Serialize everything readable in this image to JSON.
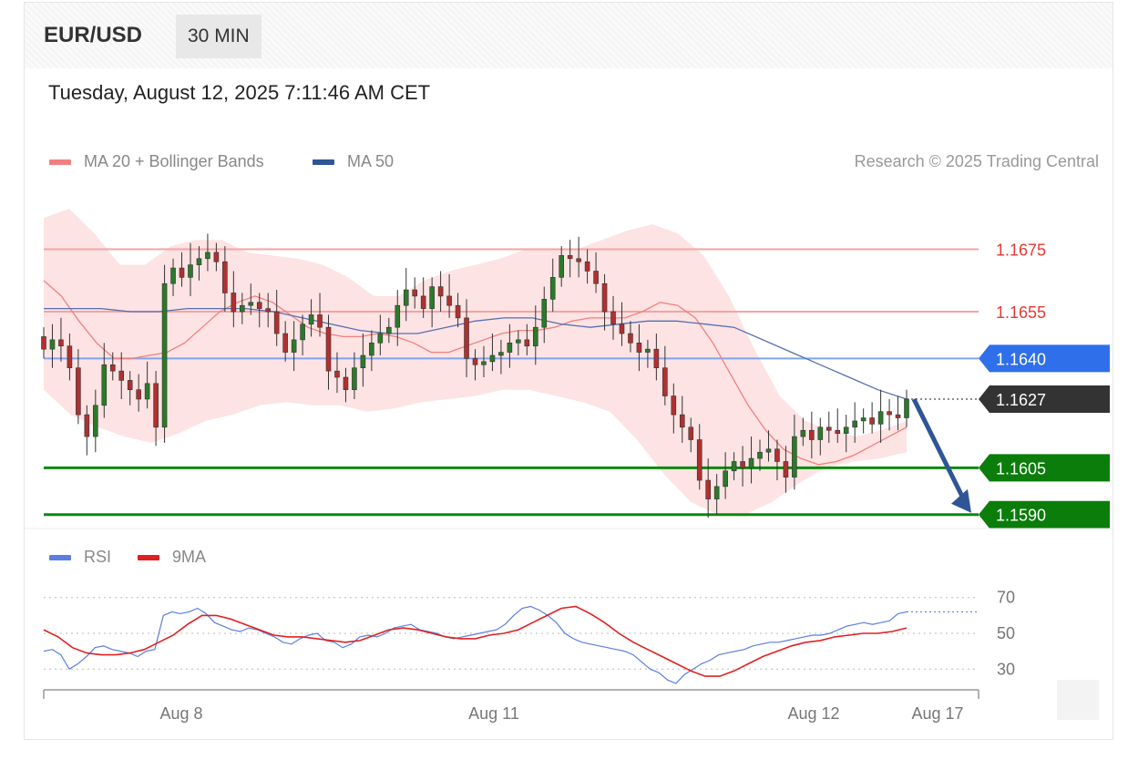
{
  "header": {
    "pair": "EUR/USD",
    "timeframe": "30 MIN"
  },
  "datetime": "Tuesday, August 12, 2025 7:11:46 AM CET",
  "legend": {
    "ma20": {
      "label": "MA 20 + Bollinger Bands",
      "color": "#f08080"
    },
    "ma50": {
      "label": "MA 50",
      "color": "#2f5597"
    }
  },
  "credit": "Research © 2025 Trading Central",
  "rsi_legend": {
    "rsi": {
      "label": "RSI",
      "color": "#5b7fe0"
    },
    "ma9": {
      "label": "9MA",
      "color": "#e02020"
    }
  },
  "chart_data": [
    {
      "type": "candlestick",
      "title": "EUR/USD",
      "timeframe": "30 MIN",
      "x_tick_labels": [
        "Aug 8",
        "Aug 11",
        "Aug 12",
        "Aug 17"
      ],
      "ylim": [
        1.1587,
        1.1695
      ],
      "levels": [
        {
          "value": 1.1675,
          "label": "1.1675",
          "kind": "resistance",
          "color": "#e53935"
        },
        {
          "value": 1.1655,
          "label": "1.1655",
          "kind": "resistance",
          "color": "#e53935"
        },
        {
          "value": 1.164,
          "label": "1.1640",
          "kind": "pivot",
          "color": "#2f6fea"
        },
        {
          "value": 1.1627,
          "label": "1.1627",
          "kind": "last_price",
          "color": "#333333"
        },
        {
          "value": 1.1605,
          "label": "1.1605",
          "kind": "support",
          "color": "#0a8a0a"
        },
        {
          "value": 1.159,
          "label": "1.1590",
          "kind": "support",
          "color": "#0a8a0a"
        }
      ],
      "close_series": [
        1.1643,
        1.1646,
        1.1644,
        1.1637,
        1.1622,
        1.1615,
        1.1625,
        1.1638,
        1.1636,
        1.1633,
        1.163,
        1.1627,
        1.1632,
        1.1618,
        1.1664,
        1.1669,
        1.1666,
        1.167,
        1.1672,
        1.1674,
        1.1671,
        1.1661,
        1.1655,
        1.1657,
        1.1658,
        1.1656,
        1.1655,
        1.1648,
        1.1642,
        1.1646,
        1.1651,
        1.1654,
        1.165,
        1.1636,
        1.1634,
        1.163,
        1.1637,
        1.1641,
        1.1645,
        1.1648,
        1.165,
        1.1657,
        1.1662,
        1.166,
        1.1656,
        1.1663,
        1.166,
        1.1657,
        1.1653,
        1.164,
        1.1638,
        1.1639,
        1.1641,
        1.1642,
        1.1645,
        1.1646,
        1.1644,
        1.165,
        1.1659,
        1.1666,
        1.1673,
        1.1672,
        1.1671,
        1.1668,
        1.1664,
        1.1655,
        1.1651,
        1.1648,
        1.1645,
        1.1642,
        1.1643,
        1.1637,
        1.1628,
        1.1622,
        1.1618,
        1.1614,
        1.1601,
        1.1595,
        1.1599,
        1.1604,
        1.1607,
        1.1605,
        1.1608,
        1.161,
        1.1611,
        1.1607,
        1.1602,
        1.1615,
        1.1617,
        1.1614,
        1.1618,
        1.1617,
        1.1616,
        1.1618,
        1.162,
        1.1621,
        1.1619,
        1.1623,
        1.1622,
        1.1621,
        1.1627
      ],
      "ma20_series": [
        1.1665,
        1.166,
        1.1652,
        1.1645,
        1.164,
        1.164,
        1.1641,
        1.1642,
        1.1645,
        1.165,
        1.1655,
        1.1658,
        1.166,
        1.1658,
        1.1654,
        1.165,
        1.1648,
        1.1647,
        1.1647,
        1.1648,
        1.1647,
        1.1645,
        1.1642,
        1.1642,
        1.1644,
        1.1646,
        1.1648,
        1.1649,
        1.1649,
        1.165,
        1.1652,
        1.1653,
        1.1653,
        1.1653,
        1.1655,
        1.1658,
        1.1657,
        1.1653,
        1.1645,
        1.1635,
        1.1625,
        1.1617,
        1.1611,
        1.1608,
        1.1606,
        1.1607,
        1.1609,
        1.1612,
        1.1615,
        1.1618
      ],
      "ma50_series": [
        1.1656,
        1.1656,
        1.1656,
        1.1655,
        1.1655,
        1.1656,
        1.1656,
        1.1656,
        1.1655,
        1.1653,
        1.1651,
        1.1649,
        1.1648,
        1.1648,
        1.165,
        1.1652,
        1.1653,
        1.1653,
        1.1651,
        1.165,
        1.1651,
        1.1652,
        1.1652,
        1.1651,
        1.165,
        1.1646,
        1.1642,
        1.1638,
        1.1634,
        1.163,
        1.1627
      ],
      "bollinger_upper": [
        1.1685,
        1.1688,
        1.168,
        1.167,
        1.167,
        1.1676,
        1.1678,
        1.1678,
        1.1674,
        1.1673,
        1.1672,
        1.167,
        1.1666,
        1.166,
        1.166,
        1.1665,
        1.1668,
        1.167,
        1.1672,
        1.1675,
        1.1675,
        1.1675,
        1.1678,
        1.1681,
        1.1683,
        1.168,
        1.1673,
        1.166,
        1.1643,
        1.1628,
        1.162,
        1.1617,
        1.1615,
        1.1617,
        1.162
      ],
      "bollinger_lower": [
        1.163,
        1.1622,
        1.1618,
        1.1615,
        1.1613,
        1.1616,
        1.162,
        1.1622,
        1.1625,
        1.1626,
        1.1625,
        1.1625,
        1.1623,
        1.1624,
        1.1626,
        1.1627,
        1.1628,
        1.163,
        1.163,
        1.1628,
        1.1626,
        1.1623,
        1.1614,
        1.1603,
        1.1594,
        1.159,
        1.159,
        1.1594,
        1.16,
        1.1605,
        1.1607,
        1.1608,
        1.161
      ],
      "forecast_arrow": {
        "from": 1.1627,
        "to": 1.159,
        "direction": "down"
      }
    },
    {
      "type": "line",
      "title": "RSI",
      "ylim": [
        22,
        78
      ],
      "y_ticks": [
        70,
        50,
        30
      ],
      "series": [
        {
          "name": "RSI",
          "color": "#5b7fe0",
          "values": [
            40,
            41,
            38,
            30,
            33,
            37,
            42,
            43,
            41,
            40,
            39,
            37,
            40,
            41,
            60,
            62,
            61,
            62,
            64,
            61,
            56,
            54,
            52,
            51,
            53,
            52,
            50,
            48,
            45,
            44,
            47,
            49,
            50,
            46,
            45,
            42,
            44,
            48,
            49,
            48,
            50,
            53,
            54,
            55,
            52,
            51,
            50,
            48,
            47,
            48,
            49,
            50,
            51,
            52,
            55,
            60,
            64,
            65,
            63,
            60,
            56,
            50,
            47,
            45,
            44,
            43,
            42,
            41,
            40,
            38,
            34,
            30,
            28,
            24,
            22,
            27,
            30,
            33,
            35,
            38,
            39,
            40,
            41,
            43,
            44,
            45,
            45,
            46,
            47,
            48,
            49,
            49,
            50,
            52,
            54,
            55,
            56,
            55,
            56,
            57,
            61,
            62
          ]
        },
        {
          "name": "9MA",
          "color": "#e02020",
          "values": [
            52,
            48,
            42,
            39,
            38,
            38,
            39,
            41,
            45,
            49,
            55,
            60,
            60,
            58,
            55,
            52,
            49,
            48,
            48,
            47,
            46,
            45,
            46,
            49,
            52,
            53,
            52,
            50,
            48,
            47,
            47,
            49,
            50,
            52,
            56,
            60,
            64,
            65,
            61,
            56,
            50,
            45,
            41,
            37,
            33,
            29,
            26,
            26,
            29,
            33,
            37,
            40,
            43,
            45,
            46,
            48,
            49,
            50,
            50,
            51,
            53
          ]
        }
      ]
    }
  ]
}
